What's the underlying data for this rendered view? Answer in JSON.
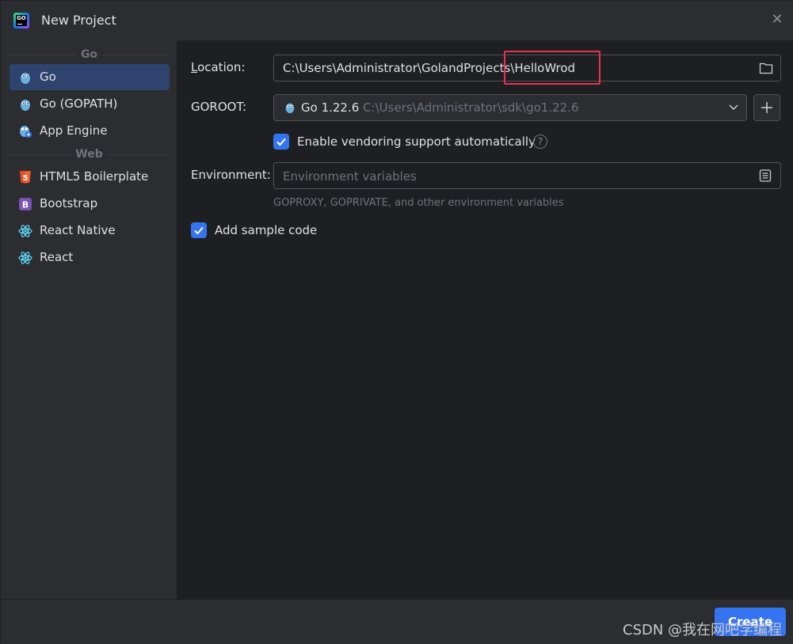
{
  "window": {
    "title": "New Project",
    "close_glyph": "✕"
  },
  "sidebar": {
    "groups": [
      {
        "header": "Go",
        "items": [
          {
            "label": "Go",
            "icon": "gopher-icon",
            "selected": true
          },
          {
            "label": "Go (GOPATH)",
            "icon": "gopher-icon"
          },
          {
            "label": "App Engine",
            "icon": "gopher-appengine-icon"
          }
        ]
      },
      {
        "header": "Web",
        "items": [
          {
            "label": "HTML5 Boilerplate",
            "icon": "html5-icon"
          },
          {
            "label": "Bootstrap",
            "icon": "bootstrap-icon"
          },
          {
            "label": "React Native",
            "icon": "react-icon"
          },
          {
            "label": "React",
            "icon": "react-icon"
          }
        ]
      }
    ]
  },
  "form": {
    "location": {
      "label_first": "L",
      "label_rest": "ocation:",
      "value_base": "C:\\Users\\Administrator\\GolandProjects\\",
      "value_name": "HelloWrod"
    },
    "goroot": {
      "label": "GOROOT:",
      "sdk_name": "Go 1.22.6",
      "sdk_path": "C:\\Users\\Administrator\\sdk\\go1.22.6"
    },
    "vendoring": {
      "label": "Enable vendoring support automatically",
      "checked": true,
      "help_glyph": "?"
    },
    "environment": {
      "label": "Environment:",
      "placeholder": "Environment variables",
      "hint": "GOPROXY, GOPRIVATE, and other environment variables"
    },
    "sample_code": {
      "label": "Add sample code",
      "checked": true
    }
  },
  "footer": {
    "create_label": "Create"
  },
  "watermark": "CSDN @我在网吧学编程",
  "colors": {
    "accent": "#3574f0",
    "highlight_box": "#e8324d",
    "selected_row": "#2e436e"
  }
}
